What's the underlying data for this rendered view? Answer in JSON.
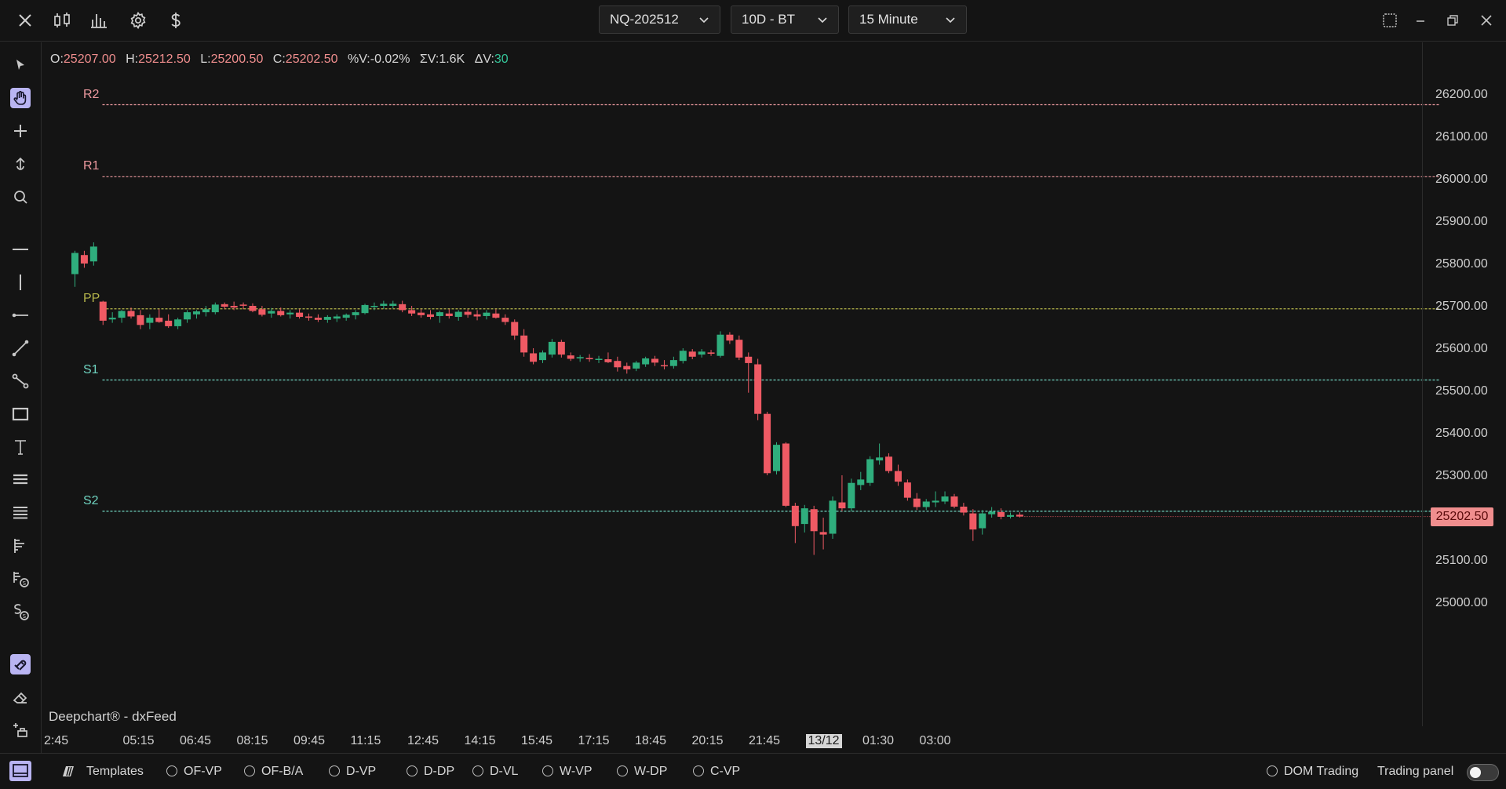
{
  "window": {
    "symbol": "NQ-202512",
    "period": "10D - BT",
    "interval": "15 Minute"
  },
  "ohlc": {
    "o_label": "O:",
    "o": "25207.00",
    "h_label": "H:",
    "h": "25212.50",
    "l_label": "L:",
    "l": "25200.50",
    "c_label": "C:",
    "c": "25202.50",
    "pv_label": "%V:",
    "pv": "-0.02%",
    "sv_label": "ΣV:",
    "sv": "1.6K",
    "dv_label": "ΔV:",
    "dv": "30"
  },
  "price_axis": {
    "labels": [
      "26200.00",
      "26100.00",
      "26000.00",
      "25900.00",
      "25800.00",
      "25700.00",
      "25600.00",
      "25500.00",
      "25400.00",
      "25300.00",
      "25200.00",
      "25100.00",
      "25000.00"
    ],
    "last_price": "25202.50"
  },
  "time_axis": {
    "labels": [
      "2:45",
      "05:15",
      "06:45",
      "08:15",
      "09:45",
      "11:15",
      "12:45",
      "14:15",
      "15:45",
      "17:15",
      "18:45",
      "20:15",
      "21:45",
      "13/12",
      "01:30",
      "03:00"
    ],
    "highlight": "13/12"
  },
  "levels": [
    {
      "name": "R2",
      "price": 26175,
      "color": "#ee9aa0"
    },
    {
      "name": "R1",
      "price": 26005,
      "color": "#ee9aa0"
    },
    {
      "name": "PP",
      "price": 25693,
      "color": "#b5b54a"
    },
    {
      "name": "S1",
      "price": 25525,
      "color": "#6fd3c0"
    },
    {
      "name": "S2",
      "price": 25215,
      "color": "#6fd3c0"
    }
  ],
  "watermark": "Deepchart® - dxFeed",
  "bottom": {
    "templates": "Templates",
    "studies": [
      "OF-VP",
      "OF-B/A",
      "D-VP",
      "D-DP",
      "D-VL",
      "W-VP",
      "W-DP",
      "C-VP"
    ],
    "dom_trading": "DOM Trading",
    "trading_panel": "Trading panel"
  },
  "colors": {
    "up": "#2fae7d",
    "down": "#ef5a64",
    "accent": "#b9b4f2"
  },
  "chart_data": {
    "type": "candlestick",
    "y_range": [
      24980,
      26240
    ],
    "candles": [
      {
        "o": 25775,
        "h": 25830,
        "l": 25745,
        "c": 25825
      },
      {
        "o": 25820,
        "h": 25830,
        "l": 25790,
        "c": 25800
      },
      {
        "o": 25805,
        "h": 25850,
        "l": 25795,
        "c": 25840
      },
      {
        "o": 25710,
        "h": 25712,
        "l": 25655,
        "c": 25665
      },
      {
        "o": 25668,
        "h": 25685,
        "l": 25660,
        "c": 25672
      },
      {
        "o": 25672,
        "h": 25690,
        "l": 25660,
        "c": 25688
      },
      {
        "o": 25688,
        "h": 25696,
        "l": 25670,
        "c": 25675
      },
      {
        "o": 25678,
        "h": 25690,
        "l": 25645,
        "c": 25655
      },
      {
        "o": 25660,
        "h": 25680,
        "l": 25645,
        "c": 25672
      },
      {
        "o": 25672,
        "h": 25692,
        "l": 25660,
        "c": 25662
      },
      {
        "o": 25665,
        "h": 25680,
        "l": 25648,
        "c": 25652
      },
      {
        "o": 25652,
        "h": 25672,
        "l": 25645,
        "c": 25668
      },
      {
        "o": 25668,
        "h": 25690,
        "l": 25660,
        "c": 25685
      },
      {
        "o": 25680,
        "h": 25690,
        "l": 25670,
        "c": 25687
      },
      {
        "o": 25685,
        "h": 25700,
        "l": 25675,
        "c": 25692
      },
      {
        "o": 25685,
        "h": 25708,
        "l": 25680,
        "c": 25703
      },
      {
        "o": 25704,
        "h": 25708,
        "l": 25692,
        "c": 25698
      },
      {
        "o": 25700,
        "h": 25710,
        "l": 25690,
        "c": 25696
      },
      {
        "o": 25703,
        "h": 25708,
        "l": 25692,
        "c": 25702
      },
      {
        "o": 25700,
        "h": 25706,
        "l": 25685,
        "c": 25688
      },
      {
        "o": 25692,
        "h": 25700,
        "l": 25675,
        "c": 25679
      },
      {
        "o": 25682,
        "h": 25695,
        "l": 25672,
        "c": 25688
      },
      {
        "o": 25688,
        "h": 25696,
        "l": 25675,
        "c": 25678
      },
      {
        "o": 25680,
        "h": 25690,
        "l": 25670,
        "c": 25684
      },
      {
        "o": 25684,
        "h": 25692,
        "l": 25670,
        "c": 25674
      },
      {
        "o": 25675,
        "h": 25682,
        "l": 25665,
        "c": 25672
      },
      {
        "o": 25672,
        "h": 25680,
        "l": 25662,
        "c": 25667
      },
      {
        "o": 25667,
        "h": 25678,
        "l": 25660,
        "c": 25674
      },
      {
        "o": 25670,
        "h": 25680,
        "l": 25662,
        "c": 25675
      },
      {
        "o": 25672,
        "h": 25682,
        "l": 25665,
        "c": 25679
      },
      {
        "o": 25678,
        "h": 25690,
        "l": 25668,
        "c": 25685
      },
      {
        "o": 25683,
        "h": 25705,
        "l": 25680,
        "c": 25702
      },
      {
        "o": 25698,
        "h": 25708,
        "l": 25690,
        "c": 25700
      },
      {
        "o": 25700,
        "h": 25712,
        "l": 25693,
        "c": 25705
      },
      {
        "o": 25700,
        "h": 25712,
        "l": 25694,
        "c": 25705
      },
      {
        "o": 25704,
        "h": 25712,
        "l": 25685,
        "c": 25690
      },
      {
        "o": 25690,
        "h": 25700,
        "l": 25676,
        "c": 25682
      },
      {
        "o": 25684,
        "h": 25692,
        "l": 25672,
        "c": 25678
      },
      {
        "o": 25680,
        "h": 25690,
        "l": 25668,
        "c": 25674
      },
      {
        "o": 25676,
        "h": 25688,
        "l": 25660,
        "c": 25685
      },
      {
        "o": 25682,
        "h": 25692,
        "l": 25670,
        "c": 25676
      },
      {
        "o": 25674,
        "h": 25690,
        "l": 25665,
        "c": 25686
      },
      {
        "o": 25686,
        "h": 25692,
        "l": 25672,
        "c": 25679
      },
      {
        "o": 25680,
        "h": 25690,
        "l": 25666,
        "c": 25675
      },
      {
        "o": 25676,
        "h": 25690,
        "l": 25668,
        "c": 25684
      },
      {
        "o": 25682,
        "h": 25692,
        "l": 25670,
        "c": 25672
      },
      {
        "o": 25672,
        "h": 25680,
        "l": 25655,
        "c": 25662
      },
      {
        "o": 25662,
        "h": 25668,
        "l": 25620,
        "c": 25630
      },
      {
        "o": 25630,
        "h": 25645,
        "l": 25580,
        "c": 25590
      },
      {
        "o": 25588,
        "h": 25600,
        "l": 25562,
        "c": 25568
      },
      {
        "o": 25572,
        "h": 25595,
        "l": 25565,
        "c": 25590
      },
      {
        "o": 25585,
        "h": 25622,
        "l": 25578,
        "c": 25615
      },
      {
        "o": 25615,
        "h": 25620,
        "l": 25578,
        "c": 25585
      },
      {
        "o": 25583,
        "h": 25590,
        "l": 25570,
        "c": 25575
      },
      {
        "o": 25576,
        "h": 25584,
        "l": 25568,
        "c": 25579
      },
      {
        "o": 25577,
        "h": 25586,
        "l": 25568,
        "c": 25574
      },
      {
        "o": 25574,
        "h": 25582,
        "l": 25565,
        "c": 25575
      },
      {
        "o": 25574,
        "h": 25590,
        "l": 25565,
        "c": 25567
      },
      {
        "o": 25570,
        "h": 25580,
        "l": 25545,
        "c": 25555
      },
      {
        "o": 25558,
        "h": 25566,
        "l": 25540,
        "c": 25550
      },
      {
        "o": 25552,
        "h": 25570,
        "l": 25546,
        "c": 25566
      },
      {
        "o": 25562,
        "h": 25580,
        "l": 25556,
        "c": 25576
      },
      {
        "o": 25575,
        "h": 25582,
        "l": 25558,
        "c": 25566
      },
      {
        "o": 25560,
        "h": 25572,
        "l": 25550,
        "c": 25558
      },
      {
        "o": 25558,
        "h": 25580,
        "l": 25552,
        "c": 25572
      },
      {
        "o": 25570,
        "h": 25600,
        "l": 25564,
        "c": 25594
      },
      {
        "o": 25592,
        "h": 25598,
        "l": 25574,
        "c": 25580
      },
      {
        "o": 25585,
        "h": 25598,
        "l": 25578,
        "c": 25592
      },
      {
        "o": 25590,
        "h": 25596,
        "l": 25582,
        "c": 25587
      },
      {
        "o": 25582,
        "h": 25640,
        "l": 25578,
        "c": 25632
      },
      {
        "o": 25632,
        "h": 25638,
        "l": 25610,
        "c": 25618
      },
      {
        "o": 25620,
        "h": 25630,
        "l": 25572,
        "c": 25578
      },
      {
        "o": 25580,
        "h": 25590,
        "l": 25495,
        "c": 25565
      },
      {
        "o": 25562,
        "h": 25575,
        "l": 25430,
        "c": 25445
      },
      {
        "o": 25445,
        "h": 25450,
        "l": 25300,
        "c": 25305
      },
      {
        "o": 25310,
        "h": 25378,
        "l": 25302,
        "c": 25372
      },
      {
        "o": 25375,
        "h": 25378,
        "l": 25225,
        "c": 25228
      },
      {
        "o": 25228,
        "h": 25235,
        "l": 25140,
        "c": 25180
      },
      {
        "o": 25185,
        "h": 25230,
        "l": 25165,
        "c": 25222
      },
      {
        "o": 25220,
        "h": 25228,
        "l": 25112,
        "c": 25168
      },
      {
        "o": 25166,
        "h": 25200,
        "l": 25125,
        "c": 25160
      },
      {
        "o": 25162,
        "h": 25250,
        "l": 25150,
        "c": 25240
      },
      {
        "o": 25236,
        "h": 25300,
        "l": 25215,
        "c": 25222
      },
      {
        "o": 25222,
        "h": 25292,
        "l": 25215,
        "c": 25282
      },
      {
        "o": 25277,
        "h": 25308,
        "l": 25265,
        "c": 25290
      },
      {
        "o": 25282,
        "h": 25345,
        "l": 25275,
        "c": 25338
      },
      {
        "o": 25335,
        "h": 25375,
        "l": 25325,
        "c": 25342
      },
      {
        "o": 25344,
        "h": 25352,
        "l": 25305,
        "c": 25310
      },
      {
        "o": 25310,
        "h": 25325,
        "l": 25275,
        "c": 25285
      },
      {
        "o": 25283,
        "h": 25290,
        "l": 25240,
        "c": 25247
      },
      {
        "o": 25245,
        "h": 25258,
        "l": 25218,
        "c": 25225
      },
      {
        "o": 25225,
        "h": 25244,
        "l": 25218,
        "c": 25238
      },
      {
        "o": 25236,
        "h": 25262,
        "l": 25225,
        "c": 25240
      },
      {
        "o": 25238,
        "h": 25262,
        "l": 25232,
        "c": 25250
      },
      {
        "o": 25250,
        "h": 25256,
        "l": 25222,
        "c": 25226
      },
      {
        "o": 25226,
        "h": 25235,
        "l": 25205,
        "c": 25212
      },
      {
        "o": 25210,
        "h": 25220,
        "l": 25145,
        "c": 25172
      },
      {
        "o": 25175,
        "h": 25218,
        "l": 25160,
        "c": 25210
      },
      {
        "o": 25208,
        "h": 25225,
        "l": 25200,
        "c": 25214
      },
      {
        "o": 25213,
        "h": 25222,
        "l": 25196,
        "c": 25202
      },
      {
        "o": 25202,
        "h": 25212,
        "l": 25198,
        "c": 25206
      },
      {
        "o": 25207,
        "h": 25212.5,
        "l": 25200.5,
        "c": 25202.5
      }
    ]
  }
}
